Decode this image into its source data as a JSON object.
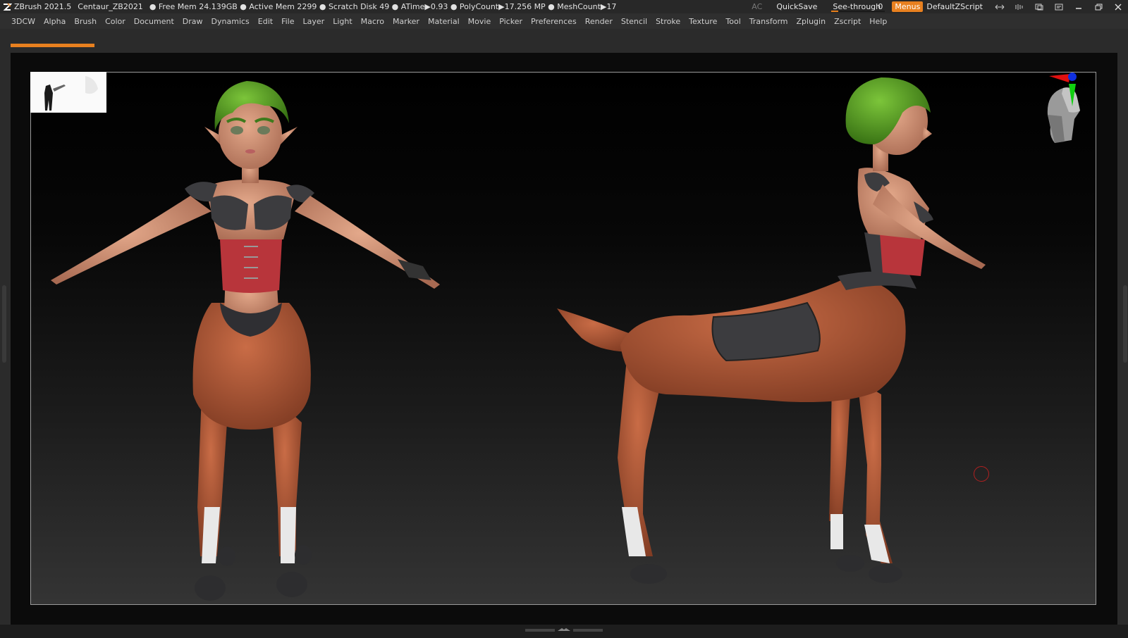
{
  "titlebar": {
    "app": "ZBrush 2021.5",
    "project": "Centaur_ZB2021",
    "stats": "● Free Mem 24.139GB ● Active Mem 2299 ● Scratch Disk 49 ●  ATime▶0.93 ● PolyCount▶17.256 MP  ● MeshCount▶17",
    "ac": "AC",
    "quicksave": "QuickSave",
    "see_through_label": "See-through",
    "see_through_value": "0",
    "menus": "Menus",
    "default_zscript": "DefaultZScript"
  },
  "menubar": {
    "items": [
      "3DCW",
      "Alpha",
      "Brush",
      "Color",
      "Document",
      "Draw",
      "Dynamics",
      "Edit",
      "File",
      "Layer",
      "Light",
      "Macro",
      "Marker",
      "Material",
      "Movie",
      "Picker",
      "Preferences",
      "Render",
      "Stencil",
      "Stroke",
      "Texture",
      "Tool",
      "Transform",
      "Zplugin",
      "Zscript",
      "Help"
    ]
  },
  "colors": {
    "accent": "#e8801f",
    "hair": "#5aa51e",
    "skin": "#d99a7a",
    "horse_body": "#b85a35",
    "corset": "#b8353b",
    "armor": "#3c3c3f",
    "axis_x": "#e01010",
    "axis_y": "#10d010",
    "axis_z": "#1030e0"
  },
  "icons": [
    "zbrush-logo-icon",
    "move-icon",
    "zoom-icon",
    "rotate-icon",
    "popup-icon",
    "minimize-icon",
    "restore-icon",
    "close-icon",
    "head-orientation-icon"
  ]
}
